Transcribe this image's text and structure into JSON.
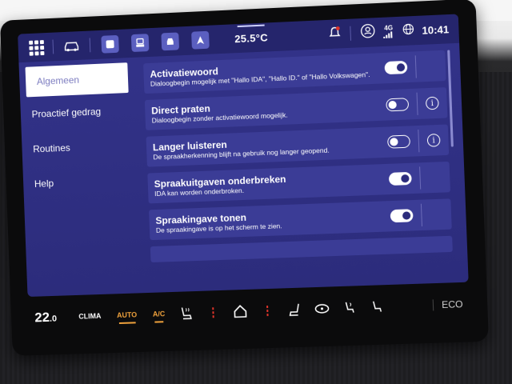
{
  "status_bar": {
    "temperature": "25.5°C",
    "network": "4G",
    "time": "10:41",
    "icons": [
      "app-grid-icon",
      "car-icon",
      "square-app-icon",
      "seat-app-icon",
      "vehicle-front-icon",
      "navigation-arrow-icon",
      "notification-bell-icon",
      "profile-icon",
      "signal-icon",
      "globe-icon"
    ]
  },
  "sidebar": {
    "items": [
      {
        "label": "Algemeen",
        "active": true
      },
      {
        "label": "Proactief gedrag",
        "active": false
      },
      {
        "label": "Routines",
        "active": false
      },
      {
        "label": "Help",
        "active": false
      }
    ]
  },
  "settings": [
    {
      "title": "Activatiewoord",
      "desc": "Dialoogbegin mogelijk met \"Hallo IDA\", \"Hallo ID.\" of \"Hallo Volkswagen\".",
      "toggle": "on",
      "info": false
    },
    {
      "title": "Direct praten",
      "desc": "Dialoogbegin zonder activatiewoord mogelijk.",
      "toggle": "off",
      "info": true
    },
    {
      "title": "Langer luisteren",
      "desc": "De spraakherkenning blijft na gebruik nog langer geopend.",
      "toggle": "off",
      "info": true
    },
    {
      "title": "Spraakuitgaven onderbreken",
      "desc": "IDA kan worden onderbroken.",
      "toggle": "on",
      "info": false
    },
    {
      "title": "Spraakingave tonen",
      "desc": "De spraakingave is op het scherm te zien.",
      "toggle": "on",
      "info": false
    }
  ],
  "climate_bar": {
    "temp_main": "22",
    "temp_decimal": ".0",
    "clima_label": "CLIMA",
    "auto_label": "AUTO",
    "ac_label": "A/C",
    "eco_label": "ECO",
    "accent_color": "#f0a23c",
    "heat_color": "#e0342a"
  },
  "colors": {
    "screen_bg": "#2c2c7c",
    "row_bg": "#3b3c96",
    "statusbar_bg": "#25256c"
  }
}
